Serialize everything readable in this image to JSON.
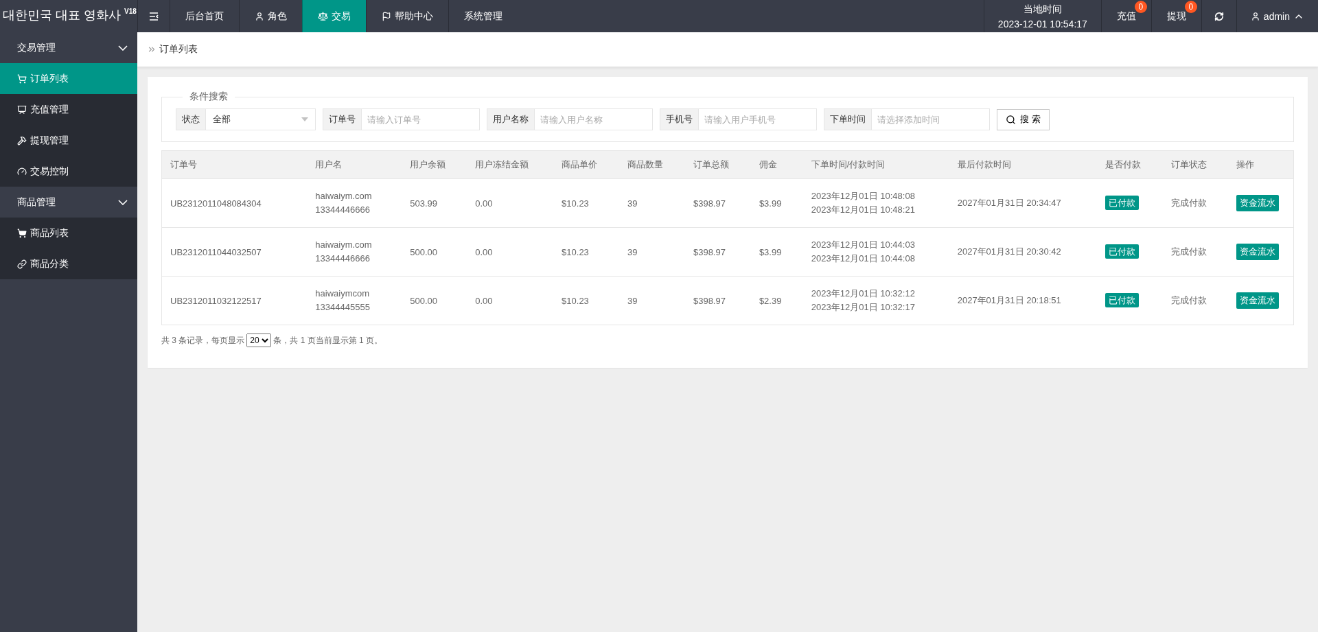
{
  "brand": {
    "title": "대한민국 대표 영화사",
    "version": "V18"
  },
  "top_nav": [
    {
      "label": "后台首页",
      "selected": false
    },
    {
      "label": "角色",
      "selected": false
    },
    {
      "label": "交易",
      "selected": true
    },
    {
      "label": "帮助中心",
      "selected": false
    },
    {
      "label": "系统管理",
      "selected": false
    }
  ],
  "clock": {
    "label": "当地时间",
    "value": "2023-12-01 10:54:17"
  },
  "top_actions": [
    {
      "label": "充值",
      "badge": "0"
    },
    {
      "label": "提现",
      "badge": "0"
    }
  ],
  "user": {
    "name": "admin"
  },
  "sidebar": [
    {
      "label": "交易管理",
      "expanded": true,
      "items": [
        {
          "label": "订单列表",
          "selected": true
        },
        {
          "label": "充值管理",
          "selected": false
        },
        {
          "label": "提现管理",
          "selected": false
        },
        {
          "label": "交易控制",
          "selected": false
        }
      ]
    },
    {
      "label": "商品管理",
      "expanded": true,
      "items": [
        {
          "label": "商品列表",
          "selected": false
        },
        {
          "label": "商品分类",
          "selected": false
        }
      ]
    }
  ],
  "breadcrumb": "订单列表",
  "search": {
    "legend": "条件搜索",
    "fields": [
      {
        "kind": "select",
        "label": "状态",
        "value": "全部"
      },
      {
        "kind": "input",
        "label": "订单号",
        "placeholder": "请输入订单号"
      },
      {
        "kind": "input",
        "label": "用户名称",
        "placeholder": "请输入用户名称"
      },
      {
        "kind": "input",
        "label": "手机号",
        "placeholder": "请输入用户手机号"
      },
      {
        "kind": "input",
        "label": "下单时间",
        "placeholder": "请选择添加时间"
      }
    ],
    "button": "搜 索"
  },
  "table": {
    "columns": [
      "订单号",
      "用户名",
      "用户余额",
      "用户冻结金额",
      "商品单价",
      "商品数量",
      "订单总额",
      "佣金",
      "下单时间/付款时间",
      "最后付款时间",
      "是否付款",
      "订单状态",
      "操作"
    ],
    "rows": [
      {
        "order_no": "UB2312011048084304",
        "user": [
          "haiwaiym.com",
          "13344446666"
        ],
        "balance": "503.99",
        "frozen": "0.00",
        "price": "$10.23",
        "qty": "39",
        "total": "$398.97",
        "commission": "$3.99",
        "times": [
          "2023年12月01日 10:48:08",
          "2023年12月01日 10:48:21"
        ],
        "last_pay": "2027年01月31日 20:34:47",
        "paid": "已付款",
        "status": "完成付款",
        "action": "资金流水"
      },
      {
        "order_no": "UB2312011044032507",
        "user": [
          "haiwaiym.com",
          "13344446666"
        ],
        "balance": "500.00",
        "frozen": "0.00",
        "price": "$10.23",
        "qty": "39",
        "total": "$398.97",
        "commission": "$3.99",
        "times": [
          "2023年12月01日 10:44:03",
          "2023年12月01日 10:44:08"
        ],
        "last_pay": "2027年01月31日 20:30:42",
        "paid": "已付款",
        "status": "完成付款",
        "action": "资金流水"
      },
      {
        "order_no": "UB2312011032122517",
        "user": [
          "haiwaiymcom",
          "13344445555"
        ],
        "balance": "500.00",
        "frozen": "0.00",
        "price": "$10.23",
        "qty": "39",
        "total": "$398.97",
        "commission": "$2.39",
        "times": [
          "2023年12月01日 10:32:12",
          "2023年12月01日 10:32:17"
        ],
        "last_pay": "2027年01月31日 20:18:51",
        "paid": "已付款",
        "status": "完成付款",
        "action": "资金流水"
      }
    ]
  },
  "pagination": {
    "before": "共 3 条记录，每页显示",
    "page_size": "20",
    "after": "条，共 1 页当前显示第 1 页。"
  }
}
